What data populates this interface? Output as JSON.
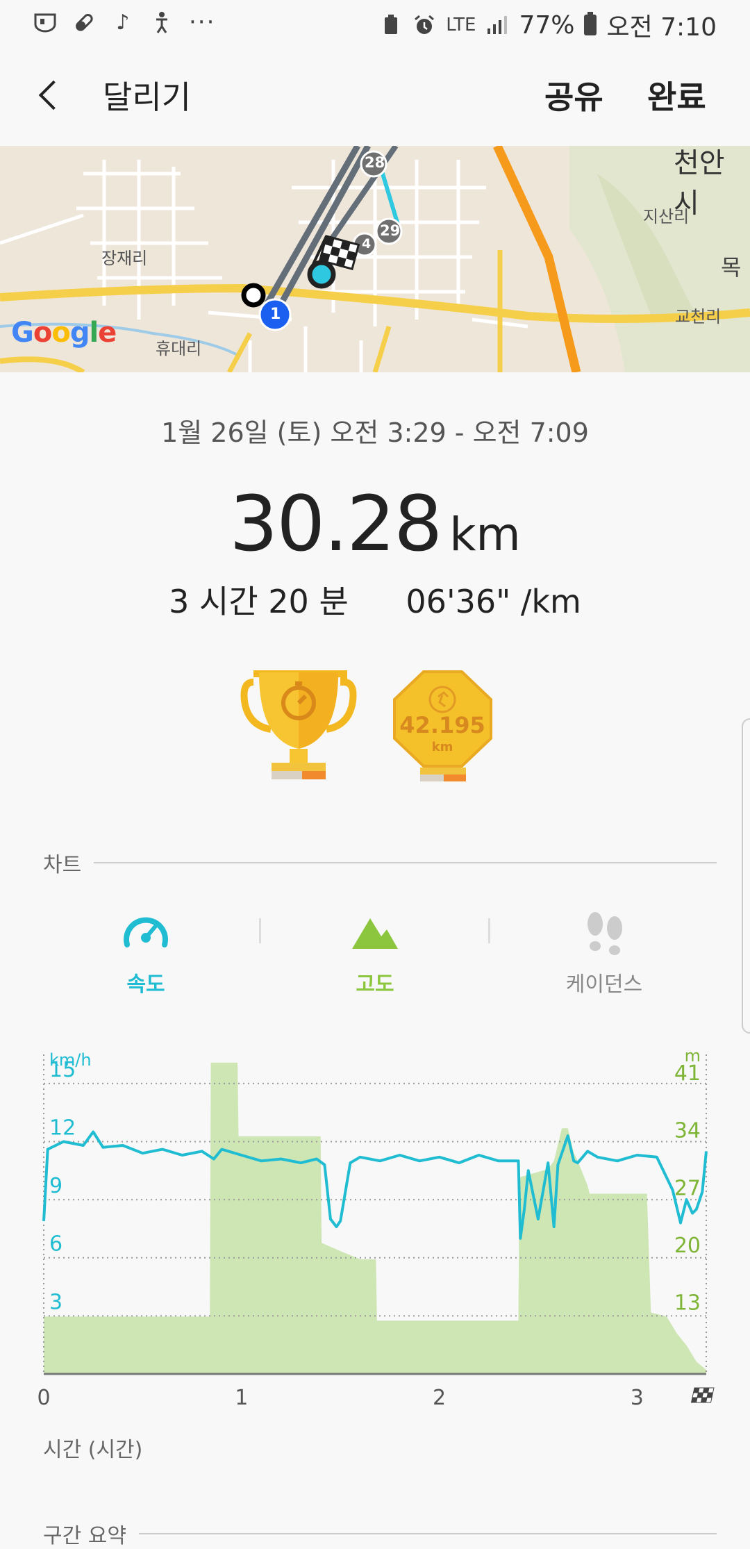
{
  "status_bar": {
    "battery": "77%",
    "time": "오전 7:10",
    "network": "LTE",
    "left_icons": [
      "samsung-health-icon",
      "pill-icon",
      "music-note-icon",
      "accessibility-icon"
    ],
    "more": "···"
  },
  "app_bar": {
    "title": "달리기",
    "share_label": "공유",
    "done_label": "완료"
  },
  "map": {
    "places": [
      "장재리",
      "휴대리",
      "지산리",
      "교천리",
      "천안시",
      "목"
    ],
    "markers": [
      "1",
      "28",
      "29",
      "4"
    ],
    "google": [
      "G",
      "o",
      "o",
      "g",
      "l",
      "e"
    ]
  },
  "summary": {
    "date_range": "1월 26일 (토) 오전 3:29 - 오전 7:09",
    "distance": "30.28",
    "distance_unit": "km",
    "duration": "3 시간 20 분",
    "pace": "06'36\" /km"
  },
  "badges": {
    "marathon_value": "42.195",
    "marathon_unit": "km"
  },
  "chart_section": {
    "title": "차트",
    "tabs": [
      {
        "label": "속도",
        "icon": "speedometer-icon",
        "color": "#1fbcd2"
      },
      {
        "label": "고도",
        "icon": "mountain-icon",
        "color": "#8cc63f"
      },
      {
        "label": "케이던스",
        "icon": "footprints-icon",
        "color": "#888888"
      }
    ]
  },
  "chart_data": {
    "type": "line",
    "left_axis_unit": "km/h",
    "right_axis_unit": "m",
    "left_ticks": [
      "3",
      "6",
      "9",
      "12",
      "15"
    ],
    "right_ticks": [
      "13",
      "20",
      "27",
      "34",
      "41"
    ],
    "x_ticks": [
      "0",
      "1",
      "2",
      "3"
    ],
    "xlabel": "시간 (시간)",
    "x_range": [
      0,
      3.35
    ],
    "y_left_range": [
      0,
      16.5
    ],
    "y_right_range": [
      6,
      45
    ],
    "grid": true,
    "series": [
      {
        "color": "#1fbcd2",
        "type": "line",
        "x": [
          0,
          0.02,
          0.1,
          0.2,
          0.25,
          0.3,
          0.4,
          0.5,
          0.6,
          0.7,
          0.8,
          0.86,
          0.9,
          1.0,
          1.1,
          1.2,
          1.3,
          1.38,
          1.42,
          1.45,
          1.48,
          1.5,
          1.55,
          1.6,
          1.7,
          1.8,
          1.9,
          2.0,
          2.1,
          2.2,
          2.3,
          2.4,
          2.41,
          2.43,
          2.45,
          2.5,
          2.55,
          2.58,
          2.6,
          2.65,
          2.68,
          2.7,
          2.75,
          2.8,
          2.9,
          3.0,
          3.1,
          3.18,
          3.22,
          3.25,
          3.28,
          3.3,
          3.33,
          3.35
        ],
        "y": [
          7.9,
          11.6,
          12.0,
          11.8,
          12.5,
          11.7,
          11.8,
          11.4,
          11.6,
          11.3,
          11.5,
          11.1,
          11.6,
          11.3,
          11.0,
          11.1,
          10.9,
          11.1,
          10.8,
          8.0,
          7.6,
          7.9,
          10.9,
          11.2,
          11.0,
          11.3,
          11.0,
          11.2,
          10.9,
          11.3,
          11.0,
          11.0,
          7.0,
          8.5,
          10.5,
          8.0,
          10.9,
          7.6,
          10.8,
          12.3,
          11.0,
          10.9,
          11.5,
          11.2,
          11.0,
          11.3,
          11.2,
          9.5,
          7.8,
          9.0,
          8.3,
          8.5,
          9.4,
          11.5
        ]
      },
      {
        "color": "#cde6b4",
        "type": "area",
        "x": [
          0,
          0.84,
          0.845,
          0.98,
          0.985,
          1.4,
          1.405,
          1.5,
          1.6,
          1.68,
          1.685,
          2.4,
          2.405,
          2.55,
          2.58,
          2.62,
          2.65,
          2.68,
          2.7,
          2.75,
          2.76,
          3.05,
          3.07,
          3.15,
          3.2,
          3.25,
          3.3,
          3.35
        ],
        "y": [
          13,
          13,
          44,
          44,
          35,
          35,
          22,
          21,
          20,
          20,
          12.5,
          12.5,
          30,
          31,
          32,
          36,
          36,
          33,
          32,
          29,
          28,
          28,
          13.5,
          13,
          11,
          9.5,
          7.5,
          6.5
        ]
      }
    ]
  },
  "next_section": {
    "title": "구간 요약"
  }
}
